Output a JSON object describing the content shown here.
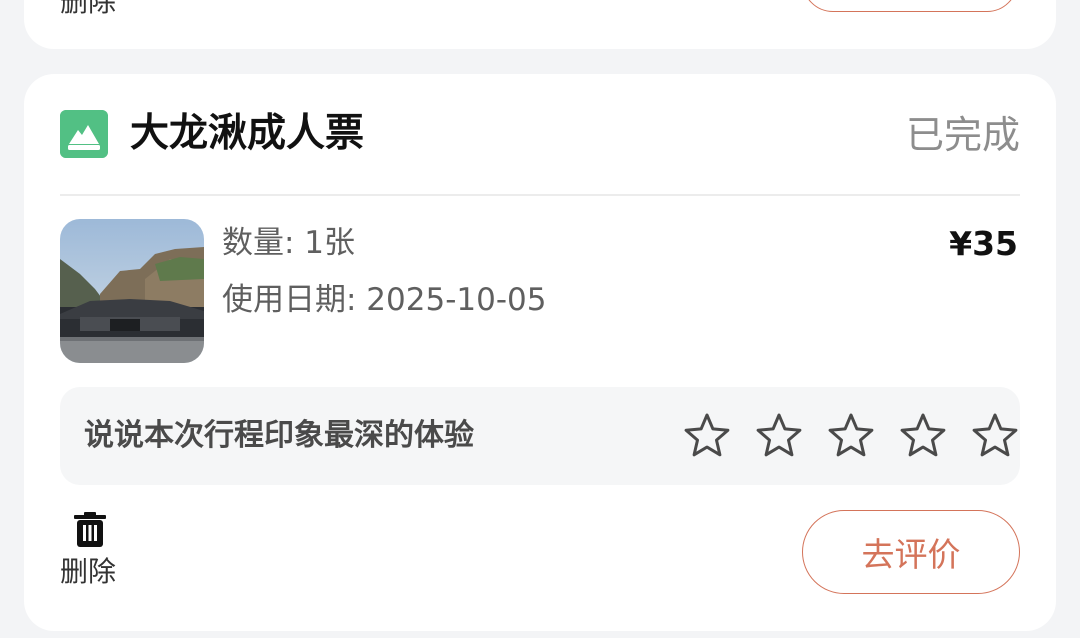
{
  "previous_order": {
    "delete_label": "删除"
  },
  "order": {
    "icon": "scenic-ticket-icon",
    "title": "大龙湫成人票",
    "status": "已完成",
    "quantity_label": "数量: 1张",
    "usage_date_label": "使用日期: 2025-10-05",
    "price": "¥35",
    "review_prompt": "说说本次行程印象最深的体验",
    "rating": {
      "max": 5,
      "value": 0
    },
    "delete_label": "删除",
    "review_button_label": "去评价"
  },
  "colors": {
    "accent": "#d4745a",
    "icon_green": "#52c084",
    "status_gray": "#8d8d8d"
  }
}
